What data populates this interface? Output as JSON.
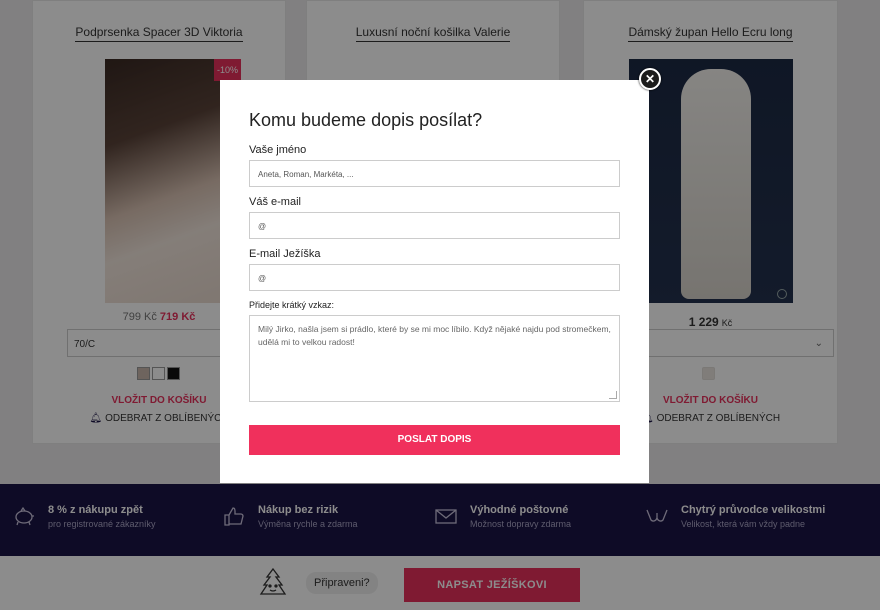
{
  "products": [
    {
      "title": "Podprsenka Spacer 3D Viktoria",
      "discount": "-10%",
      "price_old": "799 Kč",
      "price_new": "719 Kč",
      "size": "70/C",
      "swatch_colors": [
        "#c8b7ab",
        "#ffffff",
        "#111111"
      ],
      "cart_label": "VLOŽIT DO KOŠÍKU",
      "fav_label": "ODEBRAT Z OBLÍBENÝCH"
    },
    {
      "title": "Luxusní noční košilka Valerie"
    },
    {
      "title": "Dámský župan Hello Ecru long",
      "price_num": "1 229",
      "price_cur": "Kč",
      "swatch_colors": [
        "#e9e4df"
      ],
      "cart_label": "VLOŽIT DO KOŠÍKU",
      "fav_label": "ODEBRAT Z OBLÍBENÝCH"
    }
  ],
  "benefits": [
    {
      "title": "8 % z nákupu zpět",
      "subtitle": "pro registrované zákazníky",
      "icon": "piggy-bank-icon"
    },
    {
      "title": "Nákup bez rizik",
      "subtitle": "Výměna rychle a zdarma",
      "icon": "thumbs-up-icon"
    },
    {
      "title": "Výhodné poštovné",
      "subtitle": "Možnost dopravy zdarma",
      "icon": "envelope-icon"
    },
    {
      "title": "Chytrý průvodce velikostmi",
      "subtitle": "Velikost, která vám vždy padne",
      "icon": "bra-icon"
    }
  ],
  "bottom": {
    "ready_text": "Připraveni?",
    "write_button": "NAPSAT JEŽÍŠKOVI"
  },
  "modal": {
    "title": "Komu budeme dopis posílat?",
    "name_label": "Vaše jméno",
    "name_placeholder": "Aneta, Roman, Markéta, ...",
    "email_label": "Váš e-mail",
    "email_placeholder": "@",
    "santa_label": "E-mail Ježíška",
    "santa_placeholder": "@",
    "message_label": "Přidejte krátký vzkaz:",
    "message_value": "Milý Jirko, našla jsem si prádlo, které by se mi moc líbilo. Když nějaké najdu pod stromečkem, udělá mi to velkou radost!",
    "send_button": "POSLAT DOPIS"
  },
  "colors": {
    "accent": "#f0305c",
    "navy": "#1b1446"
  }
}
